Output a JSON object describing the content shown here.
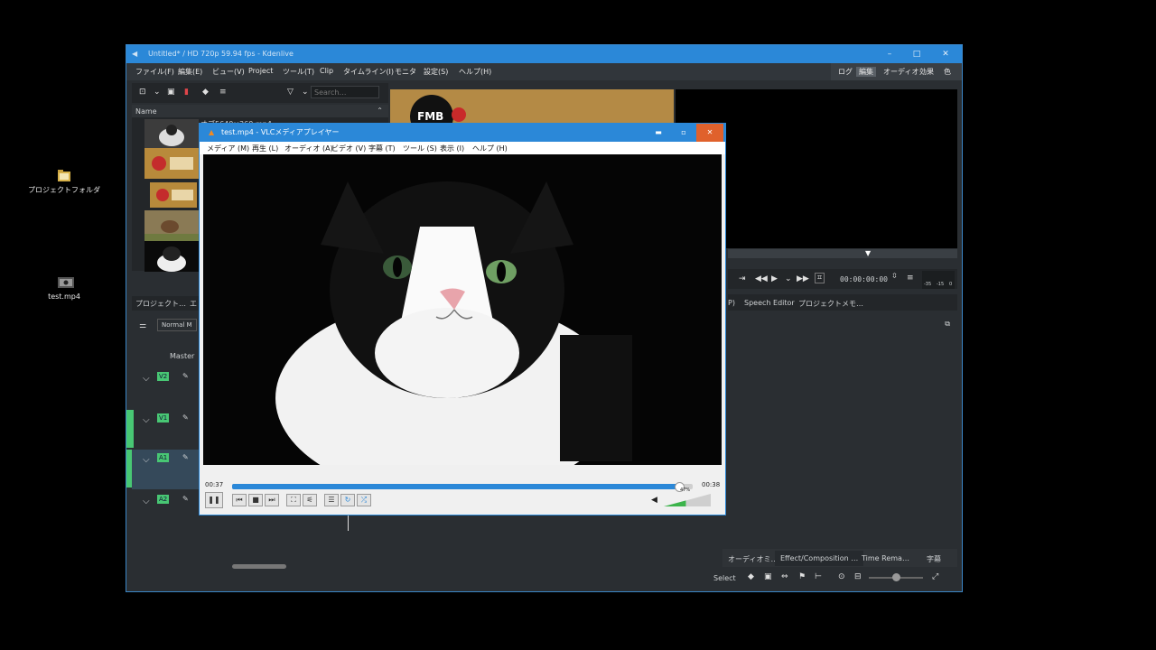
{
  "desktop": {
    "icons": [
      {
        "label": "プロジェクトフォルダ"
      },
      {
        "label": "test.mp4"
      }
    ]
  },
  "kdenlive": {
    "title": "Untitled* / HD 720p 59.94 fps - Kdenlive",
    "window_controls": {
      "minimize": "–",
      "maximize": "□",
      "close": "✕"
    },
    "menu": [
      "ファイル(F)",
      "編集(E)",
      "ビュー(V)",
      "Project",
      "ツール(T)",
      "Clip",
      "タイムライン(I)",
      "モニタ",
      "設定(S)",
      "ヘルプ(H)"
    ],
    "layouts": [
      "ログ",
      "編集",
      "オーディオ",
      "効果",
      "色"
    ],
    "active_layout": "編集",
    "bin": {
      "search_placeholder": "Search…",
      "column_name": "Name",
      "clip_title_partial": "オブ5640×360.mp4"
    },
    "left_tabs": [
      "プロジェクト…",
      "エ"
    ],
    "timeline": {
      "mode_label": "Normal M",
      "master_label": "Master",
      "tracks": [
        "V2",
        "V1",
        "A1",
        "A2"
      ]
    },
    "monitor": {
      "timecode": "00:00:00:00",
      "meter_labels": [
        "-35",
        "-15",
        "0"
      ]
    },
    "right_tabs": [
      "P)",
      "Speech Editor",
      "プロジェクトメモ…"
    ],
    "bottom_tabs": [
      "オーディオミ…",
      "Effect/Composition …",
      "Time Rema…",
      "字幕"
    ],
    "tool_label": "Select",
    "bin_logo_text": "FMB"
  },
  "vlc": {
    "title": "test.mp4 - VLCメディアプレイヤー",
    "menu": [
      "メディア (M)",
      "再生 (L)",
      "オーディオ (A)",
      "ビデオ (V)",
      "字幕 (T)",
      "ツール (S)",
      "表示 (I)",
      "ヘルプ (H)"
    ],
    "elapsed": "00:37",
    "total": "00:38",
    "progress_fraction": 0.97,
    "volume_label": "47%",
    "volume_fraction": 0.47,
    "accent": "#2b88d8"
  }
}
